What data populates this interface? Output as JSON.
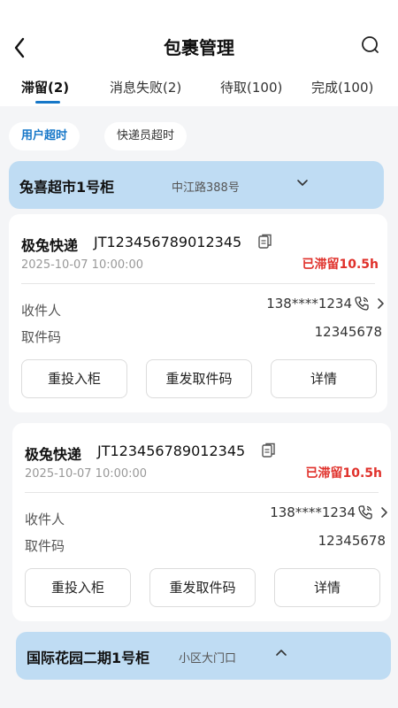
{
  "header": {
    "title": "包裹管理"
  },
  "tabs": [
    {
      "label": "滞留(2)"
    },
    {
      "label": "消息失败(2)"
    },
    {
      "label": "待取(100)"
    },
    {
      "label": "完成(100)"
    }
  ],
  "filters": [
    {
      "label": "用户超时"
    },
    {
      "label": "快递员超时"
    }
  ],
  "groups": [
    {
      "name": "兔喜超市1号柜",
      "address": "中江路388号"
    },
    {
      "name": "国际花园二期1号柜",
      "address": "小区大门口"
    }
  ],
  "card_labels": {
    "recipient": "收件人",
    "pickup_code": "取件码",
    "reinsert": "重投入柜",
    "resend_code": "重发取件码",
    "details": "详情"
  },
  "cards": [
    {
      "courier": "极兔快递",
      "tracking": "JT123456789012345",
      "time": "2025-10-07  10:00:00",
      "status": "已滞留10.5h",
      "phone": "138****1234",
      "code": "12345678"
    },
    {
      "courier": "极兔快递",
      "tracking": "JT123456789012345",
      "time": "2025-10-07  10:00:00",
      "status": "已滞留10.5h",
      "phone": "138****1234",
      "code": "12345678"
    }
  ],
  "colors": {
    "accent": "#1677c8",
    "danger": "#e0312b",
    "group_bg": "#bfdcf3"
  }
}
